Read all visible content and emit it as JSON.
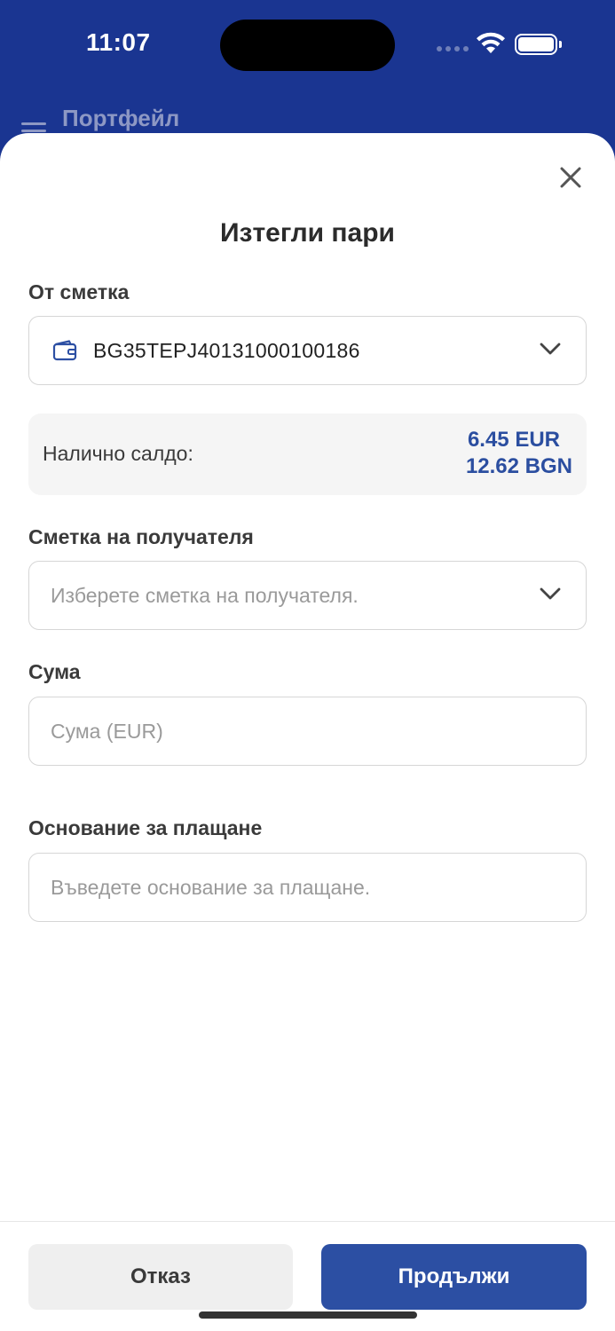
{
  "status_bar": {
    "time": "11:07"
  },
  "background_header": {
    "title": "Портфейл"
  },
  "sheet": {
    "title": "Изтегли пари",
    "from_account": {
      "label": "От сметка",
      "value": "BG35TEPJ40131000100186",
      "icon": "wallet-icon"
    },
    "balance": {
      "label": "Налично салдо:",
      "eur": "6.45 EUR",
      "bgn": "12.62 BGN"
    },
    "recipient_account": {
      "label": "Сметка на получателя",
      "placeholder": "Изберете сметка на получателя."
    },
    "amount": {
      "label": "Сума",
      "placeholder": "Сума (EUR)"
    },
    "payment_reason": {
      "label": "Основание за плащане",
      "placeholder": "Въведете основание за плащане."
    },
    "buttons": {
      "cancel": "Отказ",
      "continue": "Продължи"
    }
  },
  "colors": {
    "brand_blue": "#1a3591",
    "accent_blue": "#2c4fa3",
    "balance_blue": "#2b4ea0"
  }
}
